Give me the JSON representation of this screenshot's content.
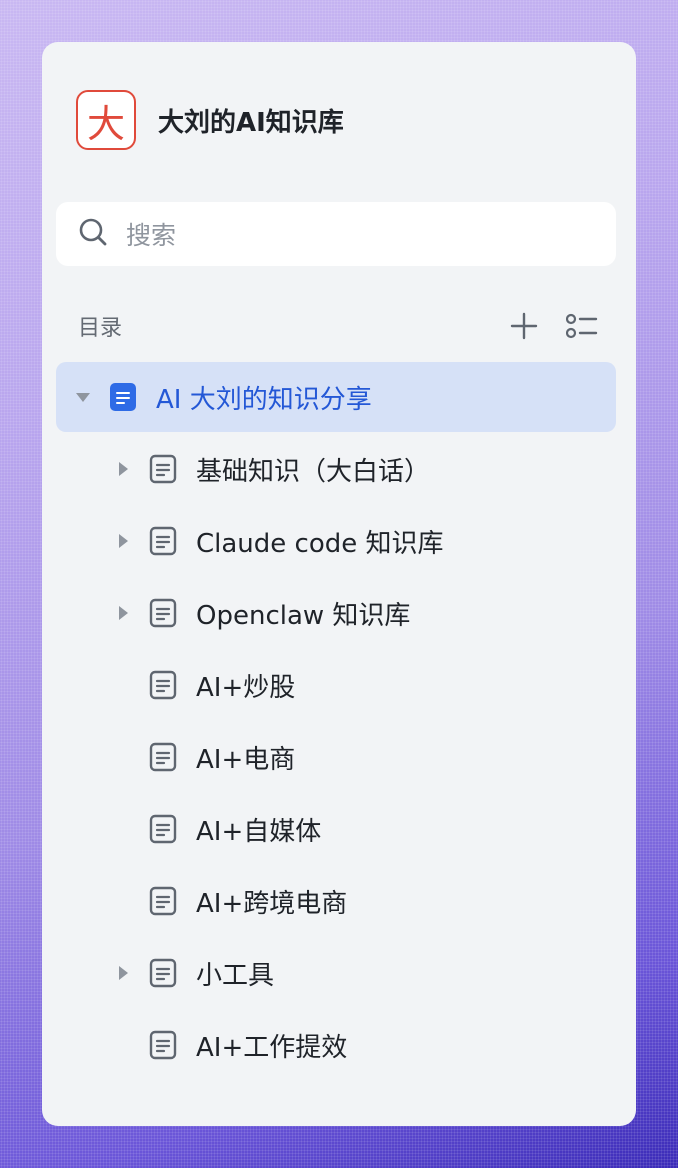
{
  "kb": {
    "logo_char": "大",
    "title": "大刘的AI知识库"
  },
  "search": {
    "placeholder": "搜索"
  },
  "toc": {
    "label": "目录"
  },
  "colors": {
    "accent": "#2458d6",
    "selected_bg": "#d6e1f7",
    "logo_red": "#e04a3b"
  },
  "tree": {
    "root": {
      "label": "AI 大刘的知识分享",
      "expanded": true
    },
    "children": [
      {
        "label": "基础知识（大白话）",
        "has_children": true
      },
      {
        "label": "Claude code 知识库",
        "has_children": true
      },
      {
        "label": "Openclaw 知识库",
        "has_children": true
      },
      {
        "label": "AI+炒股",
        "has_children": false
      },
      {
        "label": "AI+电商",
        "has_children": false
      },
      {
        "label": "AI+自媒体",
        "has_children": false
      },
      {
        "label": "AI+跨境电商",
        "has_children": false
      },
      {
        "label": "小工具",
        "has_children": true
      },
      {
        "label": "AI+工作提效",
        "has_children": false
      }
    ]
  }
}
